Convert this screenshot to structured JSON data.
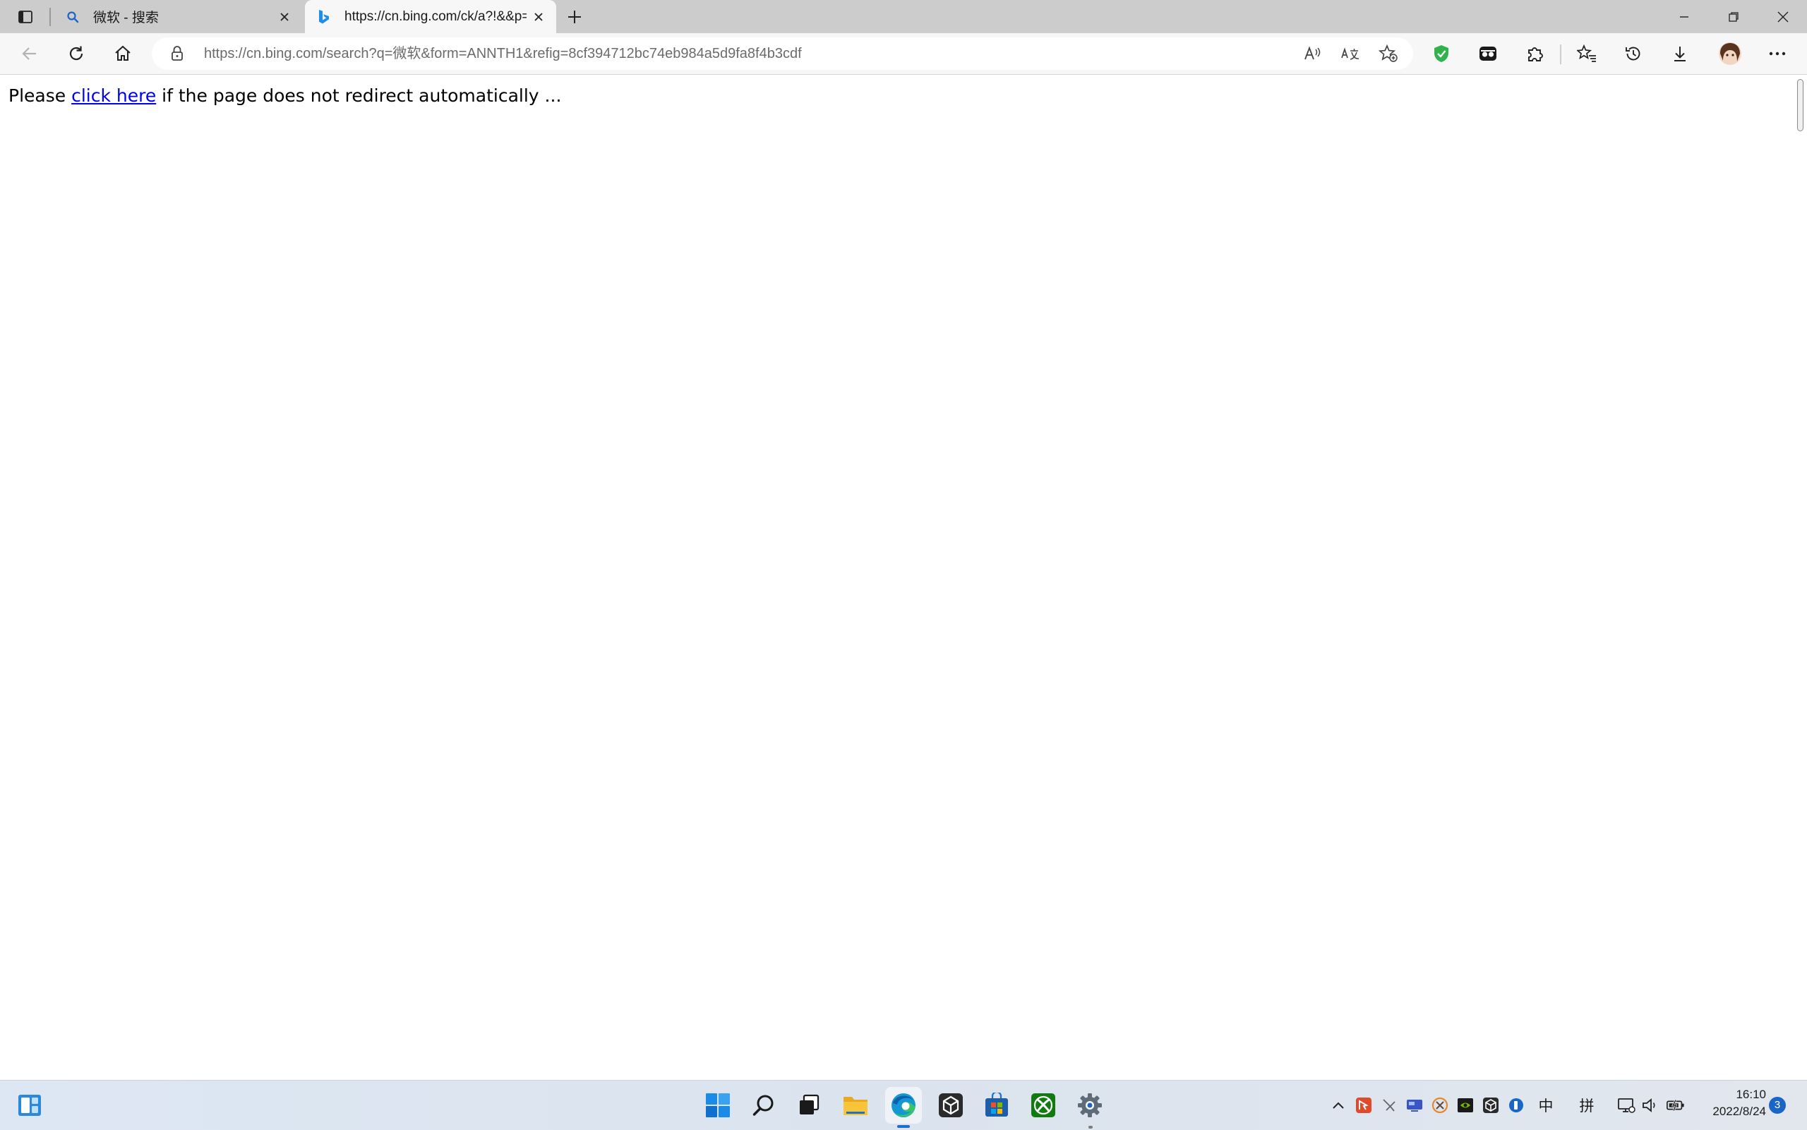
{
  "browser": {
    "tabs": [
      {
        "title": "微软 - 搜索",
        "favicon": "search-icon",
        "active": false
      },
      {
        "title": "https://cn.bing.com/ck/a?!&&p=",
        "favicon": "bing-icon",
        "active": true
      }
    ],
    "address_url": "https://cn.bing.com/search?q=微软&form=ANNTH1&refig=8cf394712bc74eb984a5d9fa8f4b3cdf",
    "accent_color": "#0078d4"
  },
  "page": {
    "message_before": "Please ",
    "link_text": "click here",
    "message_after": " if the page does not redirect automatically ..."
  },
  "taskbar": {
    "apps": [
      "start-icon",
      "search-icon",
      "task-view-icon",
      "file-explorer-icon",
      "edge-icon",
      "unity-icon",
      "microsoft-store-icon",
      "xbox-icon",
      "settings-icon"
    ],
    "ime_lang": "中",
    "ime_mode": "拼",
    "time": "16:10",
    "date": "2022/8/24",
    "notifications": "3"
  }
}
